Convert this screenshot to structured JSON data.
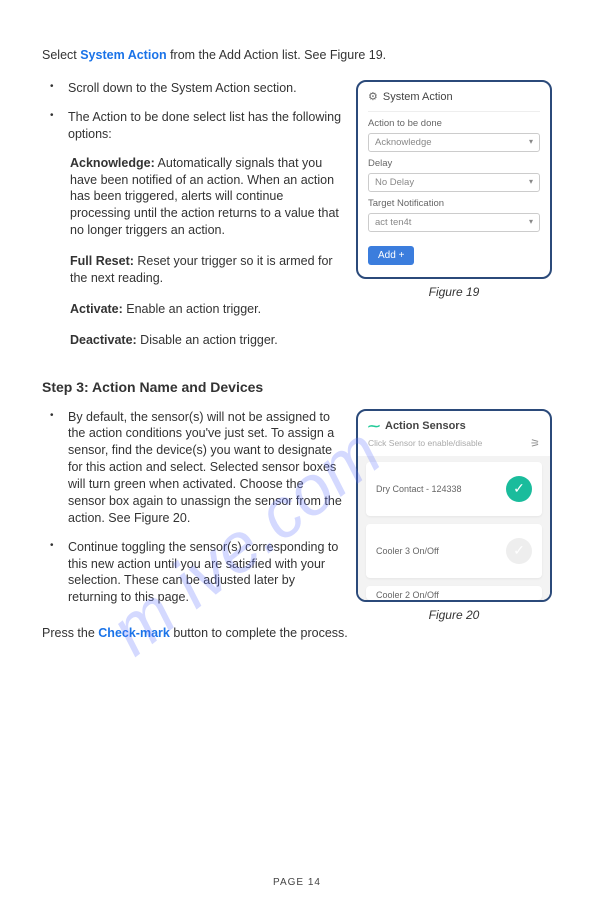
{
  "intro": {
    "pre": "Select ",
    "link": "System Action",
    "post": " from the Add Action list. See Figure 19."
  },
  "col1": {
    "b1": "Scroll down to the System Action section.",
    "b2": "The Action to be done select list has the following options:",
    "ack_label": "Acknowledge:",
    "ack_text": " Automatically signals that you have been notified of an action. When an action has been triggered, alerts will continue processing until the action returns to a value that no longer triggers an action.",
    "full_label": "Full Reset:",
    "full_text": " Reset your trigger so it is armed for the next reading.",
    "act_label": "Activate:",
    "act_text": " Enable an action trigger.",
    "deact_label": "Deactivate:",
    "deact_text": " Disable an action trigger."
  },
  "fig19": {
    "title": "System Action",
    "label1": "Action to be done",
    "val1": "Acknowledge",
    "label2": "Delay",
    "val2": "No Delay",
    "label3": "Target Notification",
    "val3": "act ten4t",
    "btn": "Add",
    "caption": "Figure 19"
  },
  "step3": "Step 3: Action Name and Devices",
  "col2": {
    "b1": "By default, the sensor(s) will not be assigned to the action conditions you've just set. To assign a sensor, find the device(s) you want to designate for this action and select. Selected sensor boxes will turn green when activated. Choose the sensor box again to unassign the sensor from the action. See Figure 20.",
    "b2": "Continue toggling the sensor(s) corresponding to this new action until you are satisfied with your selection. These can be adjusted later by returning to this page."
  },
  "fig20": {
    "title": "Action Sensors",
    "sub": "Click Sensor to enable/disable",
    "s1": "Dry Contact - 124338",
    "s2": "Cooler 3 On/Off",
    "s3": "Cooler 2 On/Off",
    "caption": "Figure 20"
  },
  "press": {
    "pre": "Press the ",
    "link": "Check-mark",
    "post": " button to complete the process."
  },
  "page": "PAGE  14",
  "watermark": "m             ive.com"
}
